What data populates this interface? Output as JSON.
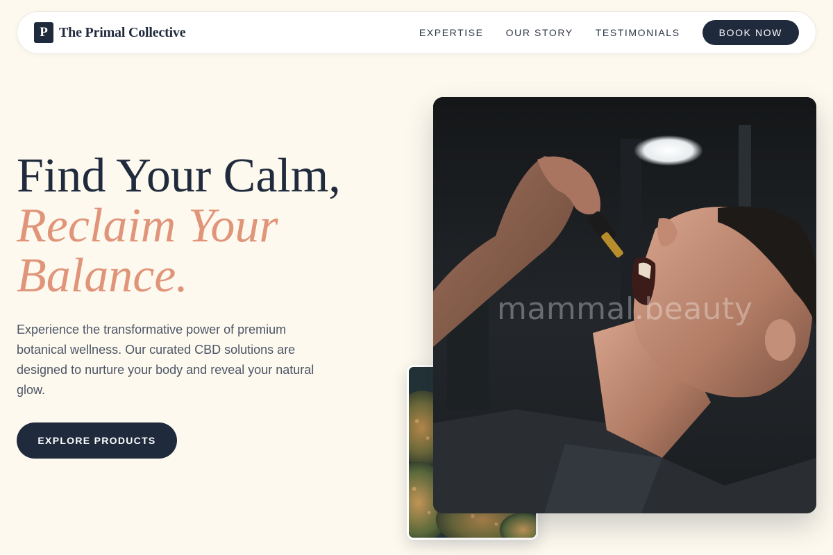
{
  "brand": {
    "mark": "P",
    "name": "The Primal Collective"
  },
  "nav": {
    "links": [
      "EXPERTISE",
      "OUR STORY",
      "TESTIMONIALS"
    ],
    "cta": "BOOK NOW"
  },
  "hero": {
    "title_line1": "Find Your Calm,",
    "title_line2": "Reclaim Your",
    "title_line3": "Balance.",
    "description": "Experience the transformative power of premium botanical wellness. Our curated CBD solutions are designed to nurture your body and reveal your natural glow.",
    "cta": "EXPLORE PRODUCTS"
  },
  "images": {
    "main_alt": "Man taking CBD oil drops from a dropper",
    "main_watermark": "mammal.beauty",
    "secondary_alt": "Close-up of cannabis flower buds"
  },
  "colors": {
    "background": "#fdf9ee",
    "navy": "#1f2a3c",
    "accent_peach": "#e0957a",
    "body_text": "#4c5566"
  }
}
